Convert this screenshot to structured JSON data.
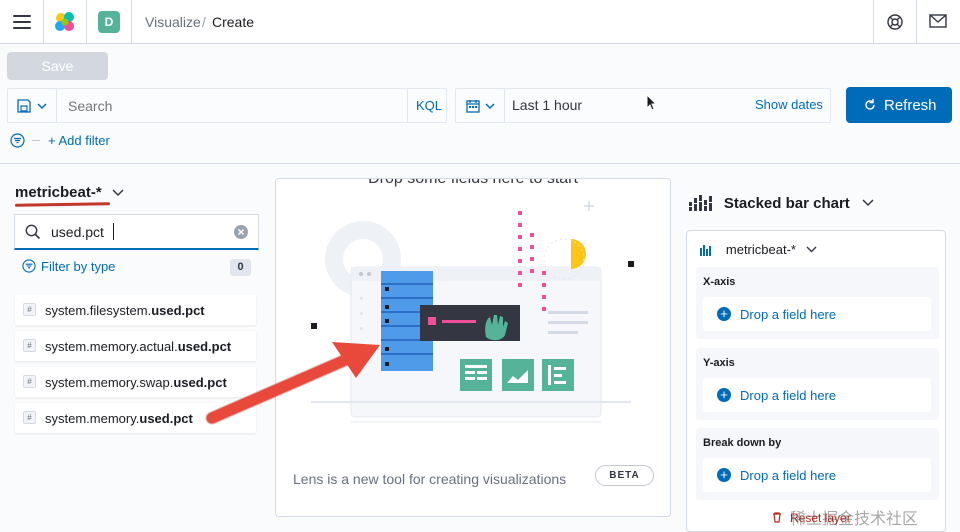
{
  "header": {
    "space_initial": "D",
    "breadcrumbs": [
      "Visualize",
      "Create"
    ],
    "breadcrumb_sep": "/",
    "brand_colors": [
      "#f04e98",
      "#00bfb3",
      "#fec514",
      "#1ba9f5",
      "#93c90e"
    ]
  },
  "toolbar": {
    "save_label": "Save"
  },
  "query": {
    "placeholder": "Search",
    "language": "KQL",
    "time_range": "Last 1 hour",
    "show_dates": "Show dates",
    "refresh_label": "Refresh",
    "add_filter": "+ Add filter"
  },
  "index_pattern": {
    "title": "metricbeat-*",
    "search_value": "used.pct",
    "filter_by_type": "Filter by type",
    "count": "0",
    "fields": [
      {
        "pre": "system.filesystem.",
        "bold": "used.pct",
        "post": ""
      },
      {
        "pre": "system.memory.actual.",
        "bold": "used.pct",
        "post": ""
      },
      {
        "pre": "system.memory.swap.",
        "bold": "used.pct",
        "post": ""
      },
      {
        "pre": "system.memory.",
        "bold": "used.pct",
        "post": ""
      }
    ],
    "field_token": "#"
  },
  "workspace": {
    "title": "Drop some fields here to start",
    "footer": "Lens is a new tool for creating visualizations",
    "badge": "BETA"
  },
  "config": {
    "chart_type": "Stacked bar chart",
    "layer_index": "metricbeat-*",
    "dimensions": [
      {
        "label": "X-axis",
        "drop": "Drop a field here"
      },
      {
        "label": "Y-axis",
        "drop": "Drop a field here"
      },
      {
        "label": "Break down by",
        "drop": "Drop a field here"
      }
    ],
    "reset_layer": "Reset layer"
  },
  "watermark": "稀土掘金技术社区",
  "colors": {
    "primary": "#006bb8",
    "accent": "#54b399",
    "annotation": "#e8493b"
  }
}
